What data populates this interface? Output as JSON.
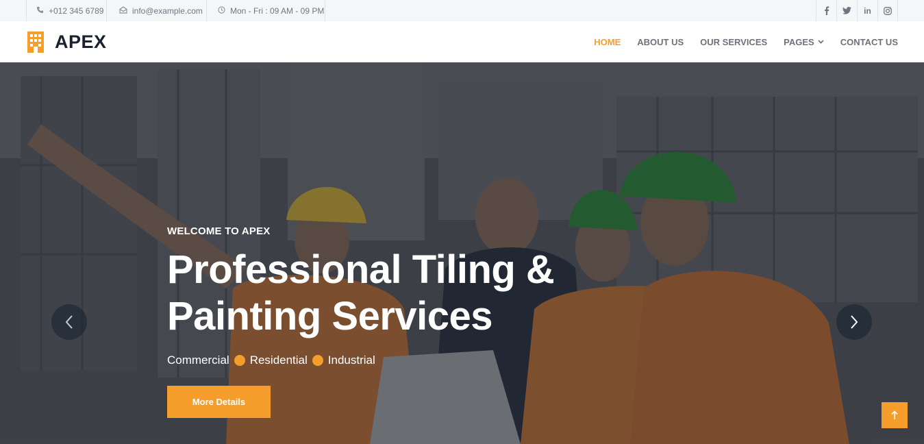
{
  "topbar": {
    "phone": "+012 345 6789",
    "email": "info@example.com",
    "hours": "Mon - Fri : 09 AM - 09 PM",
    "socials": [
      {
        "icon": "facebook-icon",
        "glyph": "f"
      },
      {
        "icon": "twitter-icon",
        "glyph": "t"
      },
      {
        "icon": "linkedin-icon",
        "glyph": "in"
      },
      {
        "icon": "instagram-icon",
        "glyph": "ig"
      }
    ]
  },
  "brand": {
    "name": "APEX",
    "icon": "building-icon"
  },
  "nav": {
    "items": [
      "HOME",
      "ABOUT US",
      "OUR SERVICES",
      "PAGES",
      "CONTACT US"
    ],
    "active_index": 0
  },
  "hero": {
    "eyebrow": "WELCOME TO APEX",
    "title_line1": "Professional Tiling &",
    "title_line2": "Painting Services",
    "tags": [
      "Commercial",
      "Residential",
      "Industrial"
    ],
    "cta": "More Details"
  },
  "colors": {
    "accent": "#f59e2c",
    "dark": "#1a2230",
    "muted": "#6c727c",
    "topbar_bg": "#f5f6f8"
  }
}
